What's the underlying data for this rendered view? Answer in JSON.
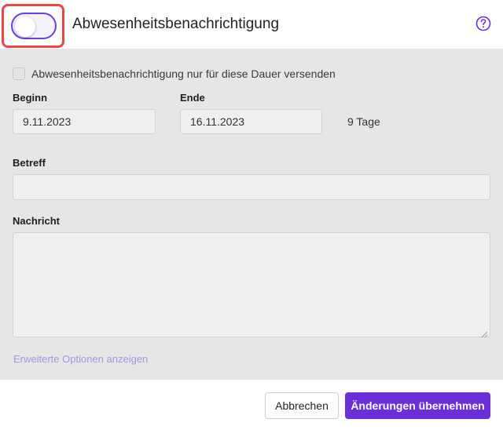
{
  "header": {
    "title": "Abwesenheitsbenachrichtigung",
    "toggle_state": "off",
    "help_icon": "question-circle-icon"
  },
  "form": {
    "duration_checkbox": {
      "label": "Abwesenheitsbenachrichtigung nur für diese Dauer versenden",
      "checked": false
    },
    "begin": {
      "label": "Beginn",
      "value": "9.11.2023"
    },
    "end": {
      "label": "Ende",
      "value": "16.11.2023"
    },
    "duration_text": "9 Tage",
    "subject": {
      "label": "Betreff",
      "value": ""
    },
    "message": {
      "label": "Nachricht",
      "value": ""
    },
    "advanced_link": "Erweiterte Optionen anzeigen"
  },
  "footer": {
    "cancel_label": "Abbrechen",
    "apply_label": "Änderungen übernehmen"
  },
  "colors": {
    "accent": "#6a2fd8",
    "highlight": "#e84848",
    "link": "#a594e6",
    "panel_bg": "#e6e6e6"
  }
}
